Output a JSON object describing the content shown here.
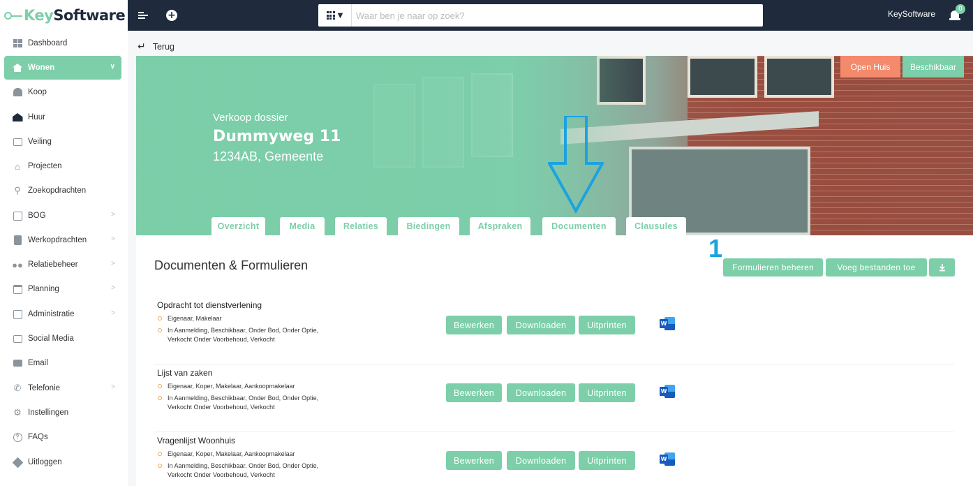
{
  "app": {
    "logo_k": "Key",
    "logo_s": "Software",
    "search_placeholder": "Waar ben je naar op zoek?",
    "user_name": "KeySoftware",
    "notifications": "0"
  },
  "sidebar": {
    "items": [
      {
        "label": "Dashboard",
        "icon": "dashboard-icon"
      },
      {
        "label": "Wonen",
        "icon": "home-icon",
        "active": true
      },
      {
        "label": "Koop",
        "icon": "buy-icon"
      },
      {
        "label": "Huur",
        "icon": "rent-icon"
      },
      {
        "label": "Veiling",
        "icon": "auction-icon"
      },
      {
        "label": "Projecten",
        "icon": "projects-icon"
      },
      {
        "label": "Zoekopdrachten",
        "icon": "search-icon"
      },
      {
        "label": "BOG",
        "icon": "building-icon"
      },
      {
        "label": "Werkopdrachten",
        "icon": "clipboard-icon"
      },
      {
        "label": "Relatiebeheer",
        "icon": "people-icon"
      },
      {
        "label": "Planning",
        "icon": "calendar-icon"
      },
      {
        "label": "Administratie",
        "icon": "ledger-icon"
      },
      {
        "label": "Social Media",
        "icon": "social-icon"
      },
      {
        "label": "Email",
        "icon": "mail-icon"
      },
      {
        "label": "Telefonie",
        "icon": "phone-icon"
      },
      {
        "label": "Instellingen",
        "icon": "gear-icon"
      },
      {
        "label": "FAQs",
        "icon": "question-icon"
      },
      {
        "label": "Uitloggen",
        "icon": "logout-icon"
      }
    ]
  },
  "back_label": "Terug",
  "hero": {
    "kicker": "Verkoop dossier",
    "title": "Dummyweg 11",
    "subtitle": "1234AB, Gemeente",
    "badge_open": "Open Huis",
    "badge_status": "Beschikbaar"
  },
  "tabs": [
    "Overzicht",
    "Media",
    "Relaties",
    "Biedingen",
    "Afspraken",
    "Documenten",
    "Clausules"
  ],
  "annotation": "1",
  "section": {
    "title": "Documenten & Formulieren",
    "btn_manage": "Formulieren beheren",
    "btn_add": "Voeg bestanden toe"
  },
  "doc_buttons": {
    "edit": "Bewerken",
    "download": "Downloaden",
    "print": "Uitprinten"
  },
  "documents": [
    {
      "title": "Opdracht tot dienstverlening",
      "roles": "Eigenaar, Makelaar",
      "status_1": "In Aanmelding, Beschikbaar, Onder Bod, Onder Optie,",
      "status_2": "Verkocht Onder Voorbehoud, Verkocht"
    },
    {
      "title": "Lijst van zaken",
      "roles": "Eigenaar, Koper, Makelaar, Aankoopmakelaar",
      "status_1": "In Aanmelding, Beschikbaar, Onder Bod, Onder Optie,",
      "status_2": "Verkocht Onder Voorbehoud, Verkocht"
    },
    {
      "title": "Vragenlijst Woonhuis",
      "roles": "Eigenaar, Koper, Makelaar, Aankoopmakelaar",
      "status_1": "In Aanmelding, Beschikbaar, Onder Bod, Onder Optie,",
      "status_2": "Verkocht Onder Voorbehoud, Verkocht"
    }
  ]
}
